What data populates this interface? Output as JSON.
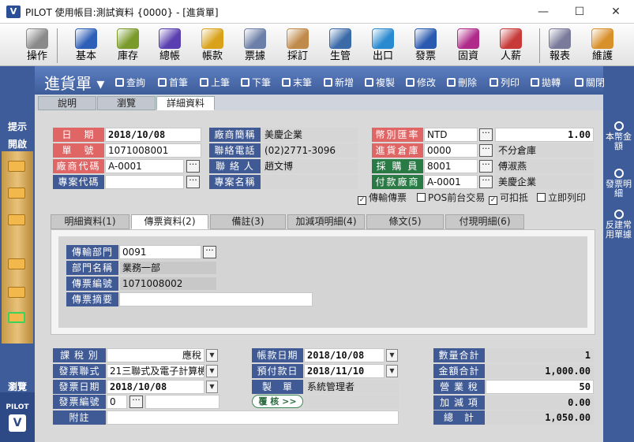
{
  "window": {
    "title": "PILOT  使用帳目:測試資料 {0000} - [進貨單]",
    "minimize": "—",
    "maximize": "☐",
    "close": "✕"
  },
  "app_logo": "V",
  "toolbar": {
    "items": [
      {
        "label": "操作",
        "color": "#8a8a8a"
      },
      {
        "label": "基本",
        "color": "#2e5fb8"
      },
      {
        "label": "庫存",
        "color": "#7a9a2a"
      },
      {
        "label": "總帳",
        "color": "#5a3fb0"
      },
      {
        "label": "帳款",
        "color": "#d9a21a"
      },
      {
        "label": "票據",
        "color": "#6c7fa8"
      },
      {
        "label": "採訂",
        "color": "#c08a4a"
      },
      {
        "label": "生管",
        "color": "#3a6aa8"
      },
      {
        "label": "出口",
        "color": "#2a8ad0"
      },
      {
        "label": "發票",
        "color": "#2a5ab0"
      },
      {
        "label": "固資",
        "color": "#b02a8a"
      },
      {
        "label": "人薪",
        "color": "#c83a3a"
      },
      {
        "label": "報表",
        "color": "#7a7a9a"
      },
      {
        "label": "維護",
        "color": "#d8902a"
      }
    ]
  },
  "sidebar": {
    "hint": "提示",
    "open": "開啟",
    "browse": "瀏覽",
    "logo_text": "PILOT",
    "logo_mark": "V"
  },
  "rightbar": {
    "items": [
      "本幣金額",
      "發票明細",
      "反建常用單據"
    ]
  },
  "actionbar": {
    "doc_title": "進貨單 ▾",
    "buttons": [
      "查詢",
      "首筆",
      "上筆",
      "下筆",
      "末筆",
      "新增",
      "複製",
      "修改",
      "刪除",
      "列印",
      "拋轉",
      "關閉"
    ]
  },
  "tabs": [
    "說明",
    "瀏覽",
    "詳細資料"
  ],
  "header": {
    "date_label": "日　期",
    "date": "2018/10/08",
    "no_label": "單　號",
    "no": "1071008001",
    "vendor_code_label": "廠商代碼",
    "vendor_code": "A-0001",
    "project_code_label": "專案代碼",
    "project_code": "",
    "vendor_name_label": "廠商簡稱",
    "vendor_name": "美慶企業",
    "phone_label": "聯絡電話",
    "phone": "(02)2771-3096",
    "contact_label": "聯 絡 人",
    "contact": "趙文博",
    "project_name_label": "專案名稱",
    "project_name": "",
    "currency_label": "幣別匯率",
    "currency": "NTD",
    "rate": "1.00",
    "warehouse_label": "進貨倉庫",
    "warehouse": "0000",
    "warehouse_name": "不分倉庫",
    "buyer_label": "採 購 員",
    "buyer": "8001",
    "buyer_name": "傅淑燕",
    "payer_label": "付款廠商",
    "payer": "A-0001",
    "payer_name": "美慶企業"
  },
  "checks": [
    {
      "label": "傳輸傳票",
      "checked": "✓"
    },
    {
      "label": "POS前台交易",
      "checked": ""
    },
    {
      "label": "可扣抵",
      "checked": "✓"
    },
    {
      "label": "立即列印",
      "checked": ""
    }
  ],
  "subtabs": [
    "明細資料(1)",
    "傳票資料(2)",
    "備註(3)",
    "加減項明細(4)",
    "條文(5)",
    "付現明細(6)"
  ],
  "voucher": {
    "dept_label": "傳輸部門",
    "dept": "0091",
    "dept_name_label": "部門名稱",
    "dept_name": "業務一部",
    "voucher_no_label": "傳票編號",
    "voucher_no": "1071008002",
    "summary_label": "傳票摘要",
    "summary": ""
  },
  "footer": {
    "tax_type_label": "課 稅 別",
    "tax_type": "應稅",
    "invoice_form_label": "發票聯式",
    "invoice_form": "21三聯式及電子計算機",
    "invoice_date_label": "發票日期",
    "invoice_date": "2018/10/08",
    "invoice_no_label": "發票編號",
    "invoice_no": "0",
    "note_label": "附註",
    "note": "",
    "account_date_label": "帳款日期",
    "account_date": "2018/10/08",
    "pay_date_label": "預付款日",
    "pay_date": "2018/11/10",
    "maker_label": "製　單",
    "maker": "系統管理者",
    "review_label": "覆 核 >>",
    "qty_label": "數量合計",
    "qty": "1",
    "amount_label": "金額合計",
    "amount": "1,000.00",
    "tax_label": "營 業 稅",
    "tax": "50",
    "adjust_label": "加 減 項",
    "adjust": "0.00",
    "total_label": "總　計",
    "total": "1,050.00"
  }
}
